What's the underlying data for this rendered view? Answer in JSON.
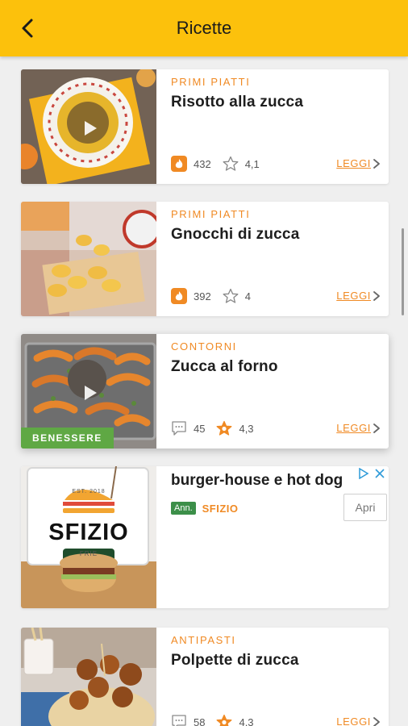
{
  "appbar": {
    "title": "Ricette",
    "back_icon": "chevron-left-icon"
  },
  "colors": {
    "appbar": "#fcc10c",
    "accent": "#f08a24",
    "badge_green": "#5fa844",
    "ad_green": "#3c8f49"
  },
  "recipes": [
    {
      "category": "PRIMI PIATTI",
      "title": "Risotto alla zucca",
      "stat1_icon": "flame-icon",
      "stat1": "432",
      "stat2_icon": "star-outline-icon",
      "stat2": "4,1",
      "read": "LEGGI",
      "has_video": true
    },
    {
      "category": "PRIMI PIATTI",
      "title": "Gnocchi di zucca",
      "stat1_icon": "flame-icon",
      "stat1": "392",
      "stat2_icon": "star-outline-icon",
      "stat2": "4",
      "read": "LEGGI",
      "has_video": false
    },
    {
      "category": "CONTORNI",
      "title": "Zucca al forno",
      "stat1_icon": "comment-icon",
      "stat1": "45",
      "stat2_icon": "star-filled-icon",
      "stat2": "4,3",
      "read": "LEGGI",
      "has_video": true,
      "badge": "BENESSERE"
    },
    {
      "category": "ANTIPASTI",
      "title": "Polpette di zucca",
      "stat1_icon": "comment-icon",
      "stat1": "58",
      "stat2_icon": "star-filled-icon",
      "stat2": "4,3",
      "read": "LEGGI",
      "has_video": false
    }
  ],
  "ad": {
    "title": "burger-house e hot dog",
    "tag": "Ann.",
    "brand": "SFIZIO",
    "cta": "Apri",
    "sign_text": "SFIZIO",
    "sign_small": "EST. 2018",
    "sign_bottom": "FRIE"
  }
}
